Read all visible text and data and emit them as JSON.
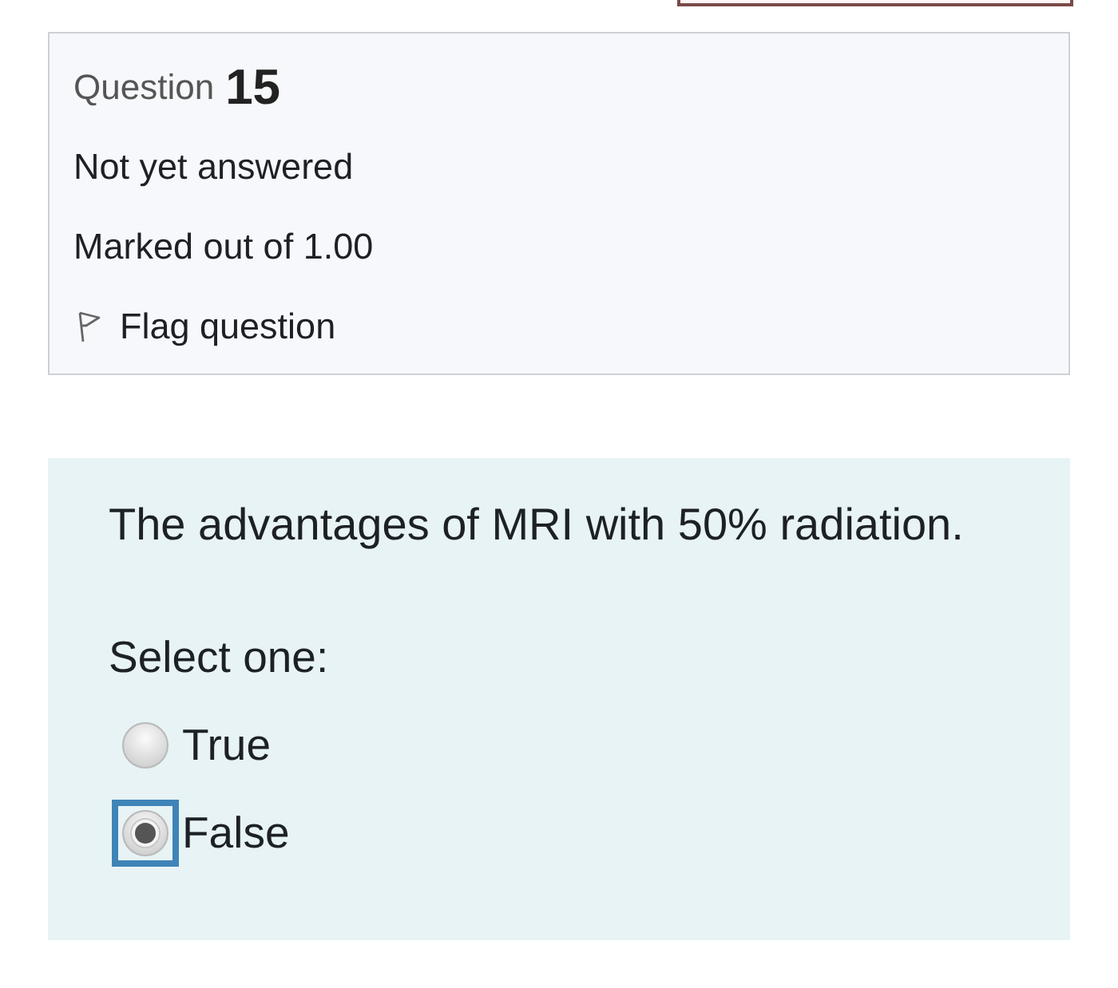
{
  "info": {
    "question_label": "Question",
    "question_number": "15",
    "state": "Not yet answered",
    "grade": "Marked out of 1.00",
    "flag": {
      "label": "Flag question",
      "flagged": false
    }
  },
  "content": {
    "question_text": "The advantages of MRI with 50% radiation.",
    "prompt": "Select one:",
    "options": [
      {
        "label": "True",
        "selected": false,
        "focused": false
      },
      {
        "label": "False",
        "selected": true,
        "focused": true
      }
    ]
  }
}
